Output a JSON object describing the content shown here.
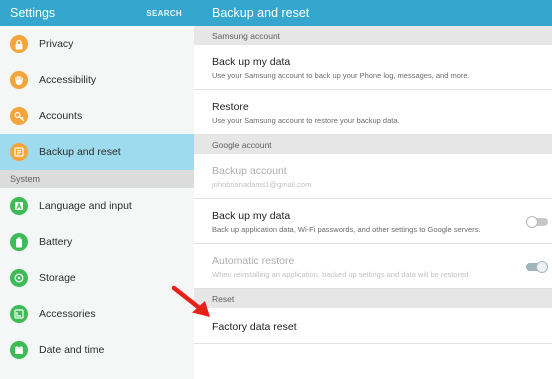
{
  "colors": {
    "header_bg": "#35a7cf",
    "selected_bg": "#9fdbee",
    "arrow": "#e8201a"
  },
  "left": {
    "title": "Settings",
    "search_label": "SEARCH",
    "items": [
      {
        "label": "Privacy",
        "icon": "lock-icon",
        "color": "#f3a43a"
      },
      {
        "label": "Accessibility",
        "icon": "hand-icon",
        "color": "#f3a43a"
      },
      {
        "label": "Accounts",
        "icon": "key-icon",
        "color": "#f3a43a"
      },
      {
        "label": "Backup and reset",
        "icon": "backup-icon",
        "color": "#f3a43a"
      }
    ],
    "section_system": "System",
    "system_items": [
      {
        "label": "Language and input",
        "icon": "language-icon",
        "color": "#3dbb56"
      },
      {
        "label": "Battery",
        "icon": "battery-icon",
        "color": "#3dbb56"
      },
      {
        "label": "Storage",
        "icon": "storage-icon",
        "color": "#3dbb56"
      },
      {
        "label": "Accessories",
        "icon": "accessories-icon",
        "color": "#3dbb56"
      },
      {
        "label": "Date and time",
        "icon": "calendar-icon",
        "color": "#3dbb56"
      }
    ]
  },
  "right": {
    "title": "Backup and reset",
    "sec_samsung": "Samsung account",
    "backup_my_data": {
      "title": "Back up my data",
      "sub": "Use your Samsung account to back up your Phone log, messages, and more."
    },
    "restore": {
      "title": "Restore",
      "sub": "Use your Samsung account to restore your backup data."
    },
    "sec_google": "Google account",
    "backup_account": {
      "title": "Backup account",
      "sub": "johnbrianadams1@gmail.com"
    },
    "google_backup": {
      "title": "Back up my data",
      "sub": "Back up application data, Wi-Fi passwords, and other settings to Google servers.",
      "toggle": "off"
    },
    "auto_restore": {
      "title": "Automatic restore",
      "sub": "When reinstalling an application, backed up settings and data will be restored.",
      "toggle": "on"
    },
    "sec_reset": "Reset",
    "factory_reset": {
      "title": "Factory data reset"
    }
  }
}
